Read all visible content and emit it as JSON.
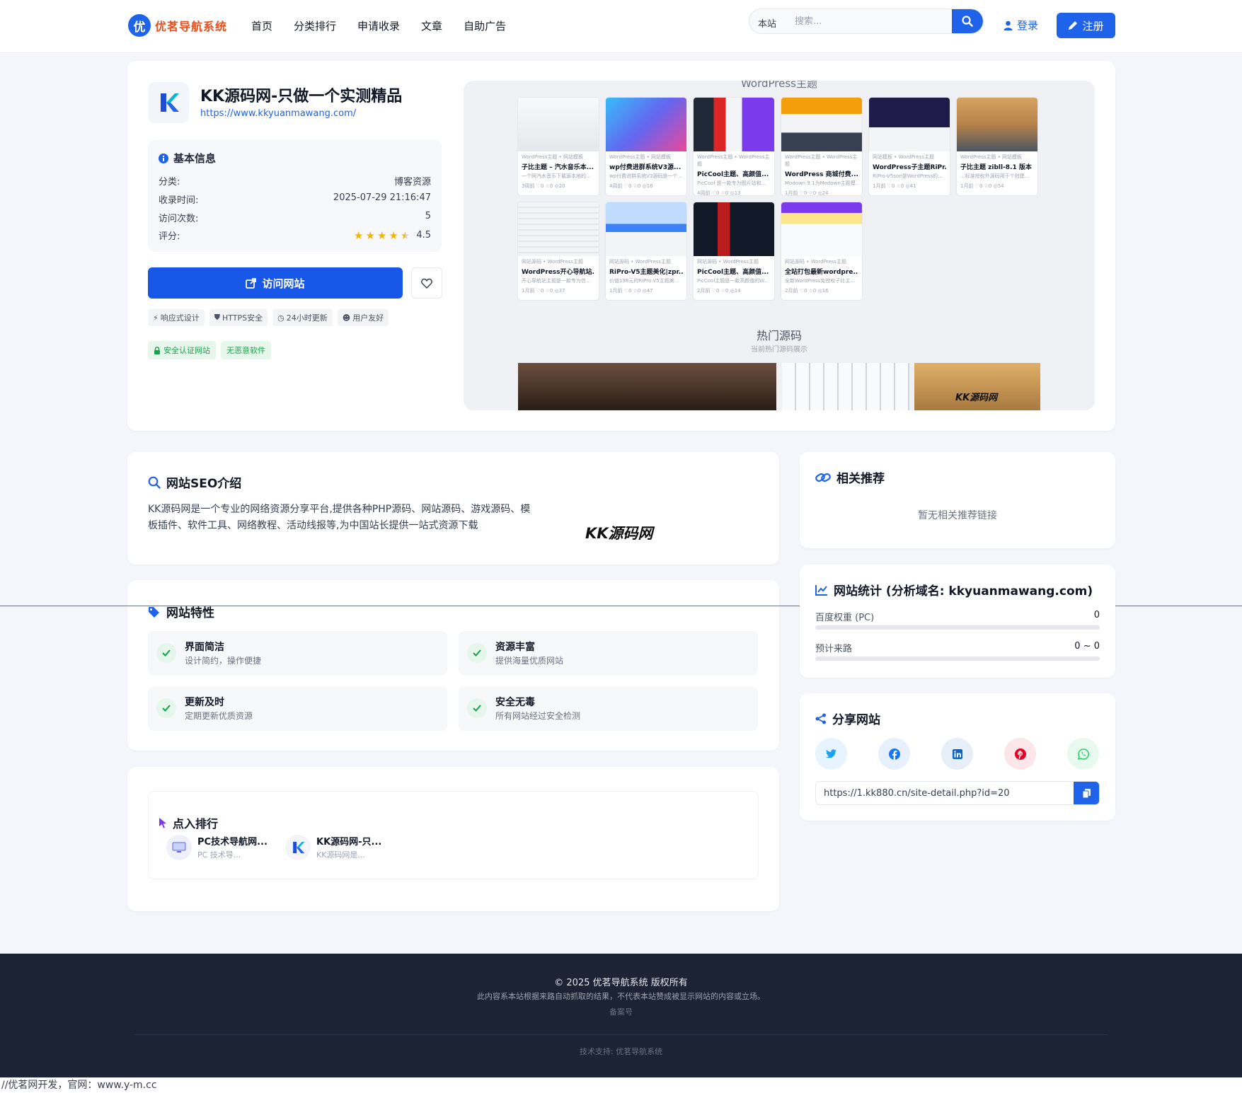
{
  "header": {
    "logo_char": "优",
    "logo_text": "优茗导航系统",
    "nav": [
      "首页",
      "分类排行",
      "申请收录",
      "文章",
      "自助广告"
    ],
    "search_scope": "本站",
    "search_placeholder": "搜索...",
    "login": "登录",
    "register": "注册"
  },
  "site": {
    "title": "KK源码网-只做一个实测精品",
    "url": "https://www.kkyuanmawang.com/",
    "info_title": "基本信息",
    "info": [
      {
        "label": "分类:",
        "value": "博客资源"
      },
      {
        "label": "收录时间:",
        "value": "2025-07-29 21:16:47"
      },
      {
        "label": "访问次数:",
        "value": "5"
      },
      {
        "label": "评分:",
        "value": "4.5"
      }
    ],
    "rating": 4.5,
    "visit_label": "访问网站",
    "tags": [
      "响应式设计",
      "HTTPS安全",
      "24小时更新",
      "用户友好"
    ],
    "badges": [
      "安全认证网站",
      "无恶意软件"
    ]
  },
  "preview": {
    "top_title": "WordPress主题",
    "hot_title": "热门源码",
    "hot_sub": "当前热门源码展示",
    "brand": "KK源码网",
    "row1": [
      {
        "cat": "WordPress主题 • 网站模板",
        "title": "子比主题 – 汽水音乐本...",
        "desc": "一个网汽水音乐下载源本地的...",
        "stat": "3周前 ♡0 ☆0 ◎20"
      },
      {
        "cat": "WordPress主题 • 网站模板",
        "title": "wp付费进群系统V3源...",
        "desc": "wp付费进群系统V3源码是一个...",
        "stat": "4周前 ♡0 ☆0 ◎16"
      },
      {
        "cat": "WordPress主题 • WordPress主题",
        "title": "PicCool主题、高颜值...",
        "desc": "PicCool 是一款专为图片站和...",
        "stat": "4周前 ♡0 ☆0 ◎13"
      },
      {
        "cat": "WordPress主题 • WordPress主题",
        "title": "WordPress 商城付费...",
        "desc": "Modown 9.1为Modown主题模...",
        "stat": "1月前 ♡0 ☆0 ◎24"
      },
      {
        "cat": "网站模板 • WordPress主题",
        "title": "WordPress子主题RiPr...",
        "desc": "RiPro-V5son是WordPress的...",
        "stat": "1月前 ♡0 ☆0 ◎41"
      },
      {
        "cat": "WordPress主题 • 网站模板",
        "title": "子比主题 zibll-8.1 版本",
        "desc": "...标准授权外源码用于个创建...",
        "stat": "1月前 ♡0 ☆0 ◎54"
      }
    ],
    "row2": [
      {
        "cat": "网站源码 • WordPress主题",
        "title": "WordPress开心导航站...",
        "desc": "开心导航站主题是一款专为信...",
        "stat": "1月前 ♡0 ☆0 ◎37"
      },
      {
        "cat": "网站源码 • WordPress主题",
        "title": "RiPro-V5主题美化|zpr...",
        "desc": "价值198元的RiPro-V5主题美...",
        "stat": "1月前 ♡0 ☆0 ◎47"
      },
      {
        "cat": "网站源码 • WordPress主题",
        "title": "PicCool主题、高颜值...",
        "desc": "PicCool主题是一款高颜值的W...",
        "stat": "2月前 ♡0 ☆0 ◎14"
      },
      {
        "cat": "网站源码 • WordPress主题",
        "title": "全站打包最新wordpre...",
        "desc": "全新WordPress免授权子比主...",
        "stat": "2月前 ♡0 ☆0 ◎16"
      }
    ]
  },
  "seo": {
    "title": "网站SEO介绍",
    "text": "KK源码网是一个专业的网络资源分享平台,提供各种PHP源码、网站源码、游戏源码、模板插件、软件工具、网络教程、活动线报等,为中国站长提供一站式资源下载",
    "watermark": "KK源码网"
  },
  "features": {
    "title": "网站特性",
    "items": [
      {
        "title": "界面简洁",
        "desc": "设计简约，操作便捷"
      },
      {
        "title": "资源丰富",
        "desc": "提供海量优质网站"
      },
      {
        "title": "更新及时",
        "desc": "定期更新优质资源"
      },
      {
        "title": "安全无毒",
        "desc": "所有网站经过安全检测"
      }
    ]
  },
  "ranking": {
    "title": "点入排行",
    "items": [
      {
        "name": "PC技术导航网...",
        "desc": "PC 技术导..."
      },
      {
        "name": "KK源码网-只...",
        "desc": "KK源码网是..."
      }
    ]
  },
  "related": {
    "title": "相关推荐",
    "empty": "暂无相关推荐链接"
  },
  "stats": {
    "title": "网站统计 (分析域名: kkyuanmawang.com)",
    "rows": [
      {
        "label": "百度权重 (PC)",
        "value": "0",
        "progress": 0
      },
      {
        "label": "预计来路",
        "value": "0 ~ 0",
        "progress": 0
      }
    ]
  },
  "share": {
    "title": "分享网站",
    "icons": [
      {
        "name": "twitter-icon",
        "color": "#1da1f2",
        "bg": "#e8f4fd"
      },
      {
        "name": "facebook-icon",
        "color": "#1877f2",
        "bg": "#e7f0fd"
      },
      {
        "name": "linkedin-icon",
        "color": "#0a66c2",
        "bg": "#e6eef8"
      },
      {
        "name": "pinterest-icon",
        "color": "#e60023",
        "bg": "#fde6ea"
      },
      {
        "name": "whatsapp-icon",
        "color": "#25d366",
        "bg": "#e8faef"
      }
    ],
    "url": "https://1.kk880.cn/site-detail.php?id=20"
  },
  "footer": {
    "copyright": "© 2025 优茗导航系统 版权所有",
    "note": "此内容系本站根据来路自动抓取的结果，不代表本站赞成被显示网站的内容或立场。",
    "beian": "备案号",
    "tech": "技术支持: 优茗导航系统"
  },
  "bottom_text": "//优茗网开发，官网：www.y-m.cc",
  "colors": {
    "primary": "#1e63e9",
    "success": "#16a34a",
    "footer_bg": "#1b2335",
    "star": "#f5b301"
  }
}
